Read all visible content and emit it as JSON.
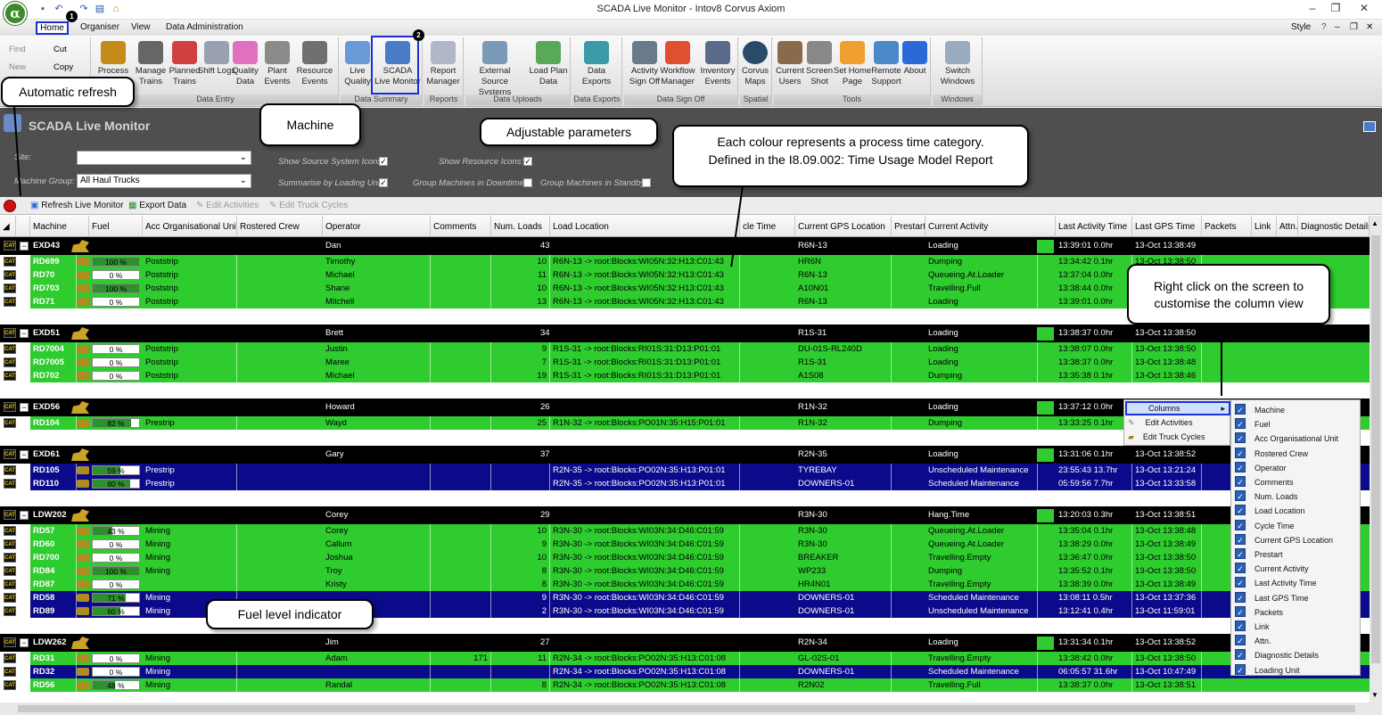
{
  "window": {
    "title": "SCADA Live Monitor - Intov8 Corvus Axiom",
    "app_icon": "α"
  },
  "menu": {
    "home": "Home",
    "organiser": "Organiser",
    "view": "View",
    "data_admin": "Data Administration",
    "style": "Style",
    "badge1": "1",
    "badge2": "2"
  },
  "ribbon": {
    "find": "Find",
    "new": "New",
    "cut": "Cut",
    "copy": "Copy",
    "process": "Process",
    "manage_trains": "Manage Trains",
    "planned_trains": "Planned Trains",
    "shift_logs": "Shift Logs",
    "quality_data": "Quality Data",
    "plant_events": "Plant Events",
    "resource_events": "Resource Events",
    "live_quality": "Live Quality",
    "scada_live": "SCADA Live Monitor",
    "report_manager": "Report Manager",
    "external_source": "External Source Systems",
    "load_plan": "Load Plan Data",
    "data_exports": "Data Exports",
    "activity_signoff": "Activity Sign Off",
    "workflow_manager": "Workflow Manager",
    "inventory_events": "Inventory Events",
    "corvus_maps": "Corvus Maps",
    "current_users": "Current Users",
    "screen_shot": "Screen Shot",
    "set_home": "Set Home Page",
    "remote_support": "Remote Support",
    "about": "About",
    "switch_windows": "Switch Windows",
    "groups": {
      "data_entry": "Data Entry",
      "data_summary": "Data Summary",
      "reports": "Reports",
      "data_uploads": "Data Uploads",
      "data_exports": "Data Exports",
      "data_signoff": "Data Sign Off",
      "spatial": "Spatial",
      "tools": "Tools",
      "windows": "Windows"
    }
  },
  "panel": {
    "title": "SCADA Live Monitor",
    "site_label": "Site:",
    "machine_group_label": "Machine Group:",
    "machine_group_value": "All Haul Trucks",
    "show_source_icons": "Show Source System Icons:",
    "summarise": "Summarise by Loading Unit:",
    "show_resource_icons": "Show Resource Icons:",
    "group_downtime": "Group Machines in Downtime:",
    "group_standby": "Group Machines in Standby:"
  },
  "toolbar": {
    "refresh": "Refresh Live Monitor",
    "export": "Export Data",
    "edit_activities": "Edit Activities",
    "edit_truck_cycles": "Edit Truck Cycles"
  },
  "columns": [
    "Machine",
    "Fuel",
    "Acc Organisational Unit",
    "Rostered Crew",
    "Operator",
    "Comments",
    "Num. Loads",
    "Load Location",
    "cle Time",
    "Current GPS Location",
    "Prestart",
    "Current Activity",
    "Last Activity Time",
    "Last GPS Time",
    "Packets",
    "Link",
    "Attn.",
    "Diagnostic Details"
  ],
  "groups": [
    {
      "machine": "EXD43",
      "operator": "Dan",
      "loads": "43",
      "gps": "R6N-13",
      "activity": "Loading",
      "last_act": "13:39:01 0.0hr",
      "last_gps": "13-Oct 13:38:49",
      "rows": [
        {
          "machine": "RD699",
          "fuel": "100 %",
          "fuel_pct": 100,
          "org": "Poststrip",
          "operator": "Timothy",
          "comments": "",
          "loads": "10",
          "loc": "R6N-13 -> root:Blocks:WI05N:32:H13:C01:43",
          "gps": "HR6N",
          "activity": "Dumping",
          "last_act": "13:34:42 0.1hr",
          "last_gps": "13-Oct 13:38:50",
          "color": "green"
        },
        {
          "machine": "RD70",
          "fuel": "0 %",
          "fuel_pct": 0,
          "org": "Poststrip",
          "operator": "Michael",
          "comments": "",
          "loads": "11",
          "loc": "R6N-13 -> root:Blocks:WI05N:32:H13:C01:43",
          "gps": "R6N-13",
          "activity": "Queueing.At.Loader",
          "last_act": "13:37:04 0.0hr",
          "last_gps": "13-Oct 13:38:50",
          "color": "green"
        },
        {
          "machine": "RD703",
          "fuel": "100 %",
          "fuel_pct": 100,
          "org": "Poststrip",
          "operator": "Shane",
          "comments": "",
          "loads": "10",
          "loc": "R6N-13 -> root:Blocks:WI05N:32:H13:C01:43",
          "gps": "A10N01",
          "activity": "Travelling.Full",
          "last_act": "13:38:44 0.0hr",
          "last_gps": "13-Oct 13:38:49",
          "color": "green"
        },
        {
          "machine": "RD71",
          "fuel": "0 %",
          "fuel_pct": 0,
          "org": "Poststrip",
          "operator": "Mitchell",
          "comments": "",
          "loads": "13",
          "loc": "R6N-13 -> root:Blocks:WI05N:32:H13:C01:43",
          "gps": "R6N-13",
          "activity": "Loading",
          "last_act": "13:39:01 0.0hr",
          "last_gps": "13-Oct 13:38:49",
          "color": "green"
        }
      ]
    },
    {
      "machine": "EXD51",
      "operator": "Brett",
      "loads": "34",
      "gps": "R1S-31",
      "activity": "Loading",
      "last_act": "13:38:37 0.0hr",
      "last_gps": "13-Oct 13:38:50",
      "rows": [
        {
          "machine": "RD7004",
          "fuel": "0 %",
          "fuel_pct": 0,
          "org": "Poststrip",
          "operator": "Justin",
          "comments": "",
          "loads": "9",
          "loc": "R1S-31 -> root:Blocks:RI01S:31:D13:P01:01",
          "gps": "DU-01S-RL240D",
          "activity": "Loading",
          "last_act": "13:38:07 0.0hr",
          "last_gps": "13-Oct 13:38:50",
          "color": "green"
        },
        {
          "machine": "RD7005",
          "fuel": "0 %",
          "fuel_pct": 0,
          "org": "Poststrip",
          "operator": "Maree",
          "comments": "",
          "loads": "7",
          "loc": "R1S-31 -> root:Blocks:RI01S:31:D13:P01:01",
          "gps": "R1S-31",
          "activity": "Loading",
          "last_act": "13:38:37 0.0hr",
          "last_gps": "13-Oct 13:38:48",
          "color": "green"
        },
        {
          "machine": "RD702",
          "fuel": "0 %",
          "fuel_pct": 0,
          "org": "Poststrip",
          "operator": "Michael",
          "comments": "",
          "loads": "19",
          "loc": "R1S-31 -> root:Blocks:RI01S:31:D13:P01:01",
          "gps": "A1S08",
          "activity": "Dumping",
          "last_act": "13:35:38 0.1hr",
          "last_gps": "13-Oct 13:38:46",
          "color": "green"
        }
      ]
    },
    {
      "machine": "EXD56",
      "operator": "Howard",
      "loads": "26",
      "gps": "R1N-32",
      "activity": "Loading",
      "last_act": "13:37:12 0.0hr",
      "last_gps": "",
      "rows": [
        {
          "machine": "RD104",
          "fuel": "82 %",
          "fuel_pct": 82,
          "org": "Prestrip",
          "operator": "Wayd",
          "comments": "",
          "loads": "25",
          "loc": "R1N-32 -> root:Blocks:PO01N:35:H15:P01:01",
          "gps": "R1N-32",
          "activity": "Dumping",
          "last_act": "13:33:25 0.1hr",
          "last_gps": "",
          "color": "green"
        }
      ]
    },
    {
      "machine": "EXD61",
      "operator": "Gary",
      "loads": "37",
      "gps": "R2N-35",
      "activity": "Loading",
      "last_act": "13:31:06 0.1hr",
      "last_gps": "13-Oct 13:38:52",
      "rows": [
        {
          "machine": "RD105",
          "fuel": "59 %",
          "fuel_pct": 59,
          "org": "Prestrip",
          "operator": "",
          "comments": "",
          "loads": "",
          "loc": "R2N-35 -> root:Blocks:PO02N:35:H13:P01:01",
          "gps": "TYREBAY",
          "activity": "Unscheduled Maintenance",
          "last_act": "23:55:43 13.7hr",
          "last_gps": "13-Oct 13:21:24",
          "color": "navy"
        },
        {
          "machine": "RD110",
          "fuel": "80 %",
          "fuel_pct": 80,
          "org": "Prestrip",
          "operator": "",
          "comments": "",
          "loads": "",
          "loc": "R2N-35 -> root:Blocks:PO02N:35:H13:P01:01",
          "gps": "DOWNERS-01",
          "activity": "Scheduled Maintenance",
          "last_act": "05:59:56 7.7hr",
          "last_gps": "13-Oct 13:33:58",
          "color": "navy"
        }
      ]
    },
    {
      "machine": "LDW202",
      "operator": "Corey",
      "loads": "29",
      "gps": "R3N-30",
      "activity": "Hang.Time",
      "last_act": "13:20:03 0.3hr",
      "last_gps": "13-Oct 13:38:51",
      "rows": [
        {
          "machine": "RD57",
          "fuel": "43 %",
          "fuel_pct": 43,
          "org": "Mining",
          "operator": "Corey",
          "comments": "",
          "loads": "10",
          "loc": "R3N-30 -> root:Blocks:WI03N:34:D46:C01:59",
          "gps": "R3N-30",
          "activity": "Queueing.At.Loader",
          "last_act": "13:35:04 0.1hr",
          "last_gps": "13-Oct 13:38:48",
          "color": "green"
        },
        {
          "machine": "RD60",
          "fuel": "0 %",
          "fuel_pct": 0,
          "org": "Mining",
          "operator": "Callum",
          "comments": "",
          "loads": "9",
          "loc": "R3N-30 -> root:Blocks:WI03N:34:D46:C01:59",
          "gps": "R3N-30",
          "activity": "Queueing.At.Loader",
          "last_act": "13:38:29 0.0hr",
          "last_gps": "13-Oct 13:38:49",
          "color": "green"
        },
        {
          "machine": "RD700",
          "fuel": "0 %",
          "fuel_pct": 0,
          "org": "Mining",
          "operator": "Joshua",
          "comments": "",
          "loads": "10",
          "loc": "R3N-30 -> root:Blocks:WI03N:34:D46:C01:59",
          "gps": "BREAKER",
          "activity": "Travelling.Empty",
          "last_act": "13:36:47 0.0hr",
          "last_gps": "13-Oct 13:38:50",
          "color": "green"
        },
        {
          "machine": "RD84",
          "fuel": "100 %",
          "fuel_pct": 100,
          "org": "Mining",
          "operator": "Troy",
          "comments": "",
          "loads": "8",
          "loc": "R3N-30 -> root:Blocks:WI03N:34:D46:C01:59",
          "gps": "WP233",
          "activity": "Dumping",
          "last_act": "13:35:52 0.1hr",
          "last_gps": "13-Oct 13:38:50",
          "color": "green"
        },
        {
          "machine": "RD87",
          "fuel": "0 %",
          "fuel_pct": 0,
          "org": "",
          "operator": "Kristy",
          "comments": "",
          "loads": "8",
          "loc": "R3N-30 -> root:Blocks:WI03N:34:D46:C01:59",
          "gps": "HR4N01",
          "activity": "Travelling.Empty",
          "last_act": "13:38:39 0.0hr",
          "last_gps": "13-Oct 13:38:49",
          "color": "green"
        },
        {
          "machine": "RD58",
          "fuel": "71 %",
          "fuel_pct": 71,
          "org": "Mining",
          "operator": "",
          "comments": "",
          "loads": "9",
          "loc": "R3N-30 -> root:Blocks:WI03N:34:D46:C01:59",
          "gps": "DOWNERS-01",
          "activity": "Scheduled Maintenance",
          "last_act": "13:08:11 0.5hr",
          "last_gps": "13-Oct 13:37:36",
          "color": "navy"
        },
        {
          "machine": "RD89",
          "fuel": "60 %",
          "fuel_pct": 60,
          "org": "Mining",
          "operator": "",
          "comments": "",
          "loads": "2",
          "loc": "R3N-30 -> root:Blocks:WI03N:34:D46:C01:59",
          "gps": "DOWNERS-01",
          "activity": "Unscheduled Maintenance",
          "last_act": "13:12:41 0.4hr",
          "last_gps": "13-Oct 11:59:01",
          "color": "navy"
        }
      ]
    },
    {
      "machine": "LDW262",
      "operator": "Jim",
      "loads": "27",
      "gps": "R2N-34",
      "activity": "Loading",
      "last_act": "13:31:34 0.1hr",
      "last_gps": "13-Oct 13:38:52",
      "rows": [
        {
          "machine": "RD31",
          "fuel": "0 %",
          "fuel_pct": 0,
          "org": "Mining",
          "operator": "Adam",
          "comments": "171",
          "loads": "11",
          "loc": "R2N-34 -> root:Blocks:PO02N:35:H13:C01:08",
          "gps": "GL-02S-01",
          "activity": "Travelling.Empty",
          "last_act": "13:38:42 0.0hr",
          "last_gps": "13-Oct 13:38:50",
          "color": "green"
        },
        {
          "machine": "RD32",
          "fuel": "0 %",
          "fuel_pct": 0,
          "org": "Mining",
          "operator": "",
          "comments": "",
          "loads": "",
          "loc": "R2N-34 -> root:Blocks:PO02N:35:H13:C01:08",
          "gps": "DOWNERS-01",
          "activity": "Scheduled Maintenance",
          "last_act": "06:05:57 31.6hr",
          "last_gps": "13-Oct 10:47:49",
          "color": "navy"
        },
        {
          "machine": "RD56",
          "fuel": "48 %",
          "fuel_pct": 48,
          "org": "Mining",
          "operator": "Randal",
          "comments": "",
          "loads": "8",
          "loc": "R2N-34 -> root:Blocks:PO02N:35:H13:C01:08",
          "gps": "R2N02",
          "activity": "Travelling.Full",
          "last_act": "13:38:37 0.0hr",
          "last_gps": "13-Oct 13:38:51",
          "color": "green"
        }
      ]
    }
  ],
  "callouts": {
    "auto_refresh": "Automatic refresh",
    "machine": "Machine",
    "adjustable": "Adjustable parameters",
    "colour_line1": "Each colour represents a process time category.",
    "colour_line2": "Defined in the I8.09.002: Time Usage Model Report",
    "right_click": "Right click on the screen to customise the column view",
    "fuel": "Fuel level indicator"
  },
  "context_menu": {
    "columns": "Columns",
    "edit_activities": "Edit Activities",
    "edit_truck_cycles": "Edit Truck Cycles",
    "column_items": [
      "Machine",
      "Fuel",
      "Acc Organisational Unit",
      "Rostered Crew",
      "Operator",
      "Comments",
      "Num. Loads",
      "Load Location",
      "Cycle Time",
      "Current GPS Location",
      "Prestart",
      "Current Activity",
      "Last Activity Time",
      "Last GPS Time",
      "Packets",
      "Link",
      "Attn.",
      "Diagnostic Details",
      "Loading Unit"
    ]
  },
  "colors": {
    "green": "#2ecc2e",
    "navy": "#0a0a8a",
    "accent": "#1930d8"
  }
}
